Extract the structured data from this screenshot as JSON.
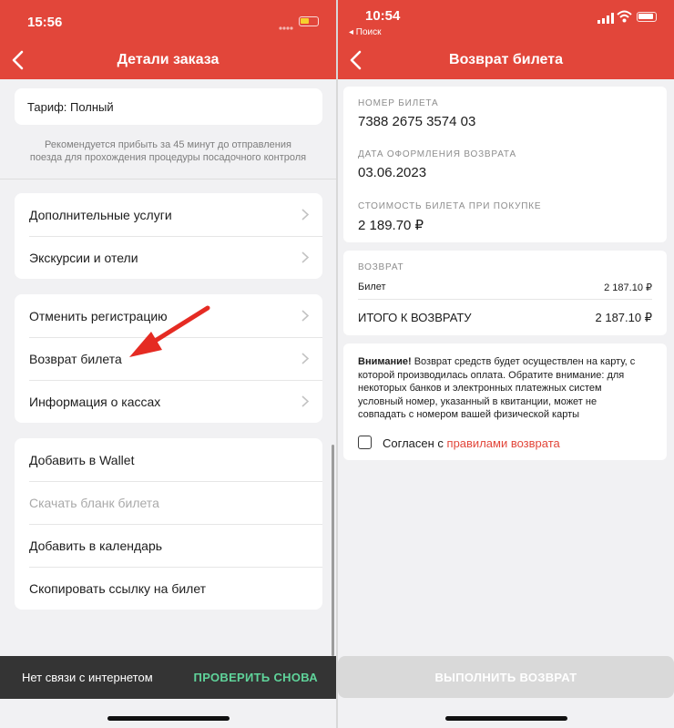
{
  "left": {
    "status_time": "15:56",
    "title": "Детали заказа",
    "tariff": "Тариф: Полный",
    "recommend": [
      "Рекомендуется прибыть за 45 минут до отправления",
      "поезда для прохождения процедуры посадочного контроля"
    ],
    "group1": [
      "Дополнительные услуги",
      "Экскурсии и отели"
    ],
    "group2": [
      "Отменить регистрацию",
      "Возврат билета",
      "Информация о кассах"
    ],
    "group3": [
      "Добавить в Wallet",
      "Скачать бланк билета",
      "Добавить в календарь",
      "Скопировать ссылку на билет"
    ],
    "offline_text": "Нет связи с интернетом",
    "retry_label": "ПРОВЕРИТЬ СНОВА"
  },
  "right": {
    "status_time": "10:54",
    "back_app": "◂ Поиск",
    "title": "Возврат билета",
    "ticket_number_label": "НОМЕР БИЛЕТА",
    "ticket_number": "7388 2675 3574 03",
    "refund_date_label": "ДАТА ОФОРМЛЕНИЯ ВОЗВРАТА",
    "refund_date": "03.06.2023",
    "price_label": "СТОИМОСТЬ БИЛЕТА ПРИ ПОКУПКЕ",
    "price": "2 189.70 ₽",
    "refund_section": "ВОЗВРАТ",
    "ticket_line_label": "Билет",
    "ticket_line_value": "2 187.10 ₽",
    "total_label": "ИТОГО К ВОЗВРАТУ",
    "total_value": "2 187.10 ₽",
    "warning_bold": "Внимание!",
    "warning_lines": [
      " Возврат средств будет осуществлен на карту, с",
      "которой производилась оплата. Обратите внимание: для",
      "некоторых банков и электронных платежных систем",
      "условный номер, указанный в квитанции, может не",
      "совпадать с номером вашей физической карты"
    ],
    "agree_text": "Согласен с ",
    "agree_link": "правилами возврата",
    "submit_label": "ВЫПОЛНИТЬ ВОЗВРАТ"
  },
  "colors": {
    "brand_red": "#e2463a",
    "retry_green": "#5fd39a"
  }
}
